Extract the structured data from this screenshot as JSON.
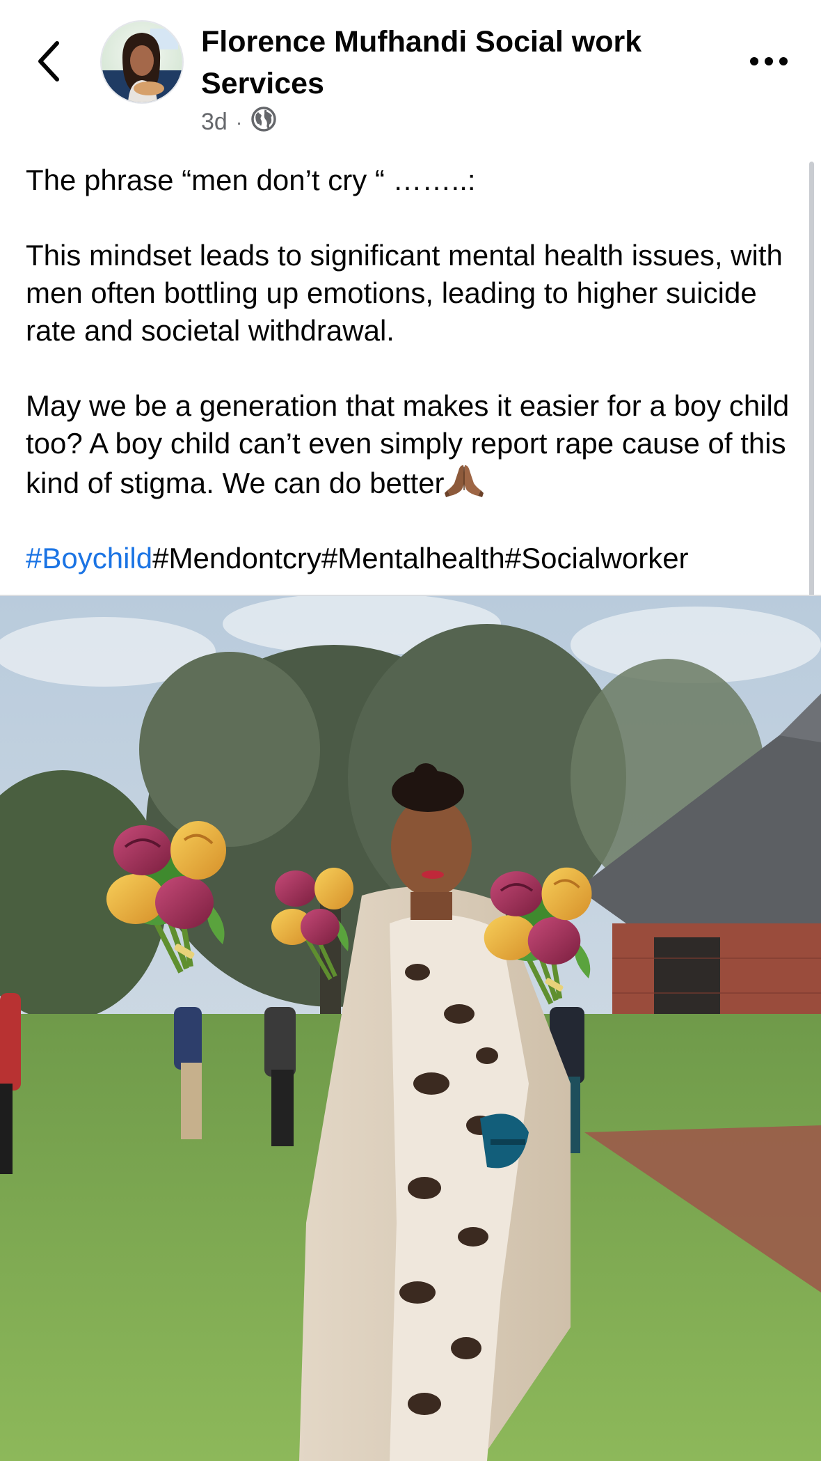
{
  "header": {
    "back_icon": "chevron-left-icon",
    "author_name": "Florence Mufhandi Social work Services",
    "timestamp": "3d",
    "separator": "·",
    "privacy_icon": "globe-icon",
    "more_icon": "more-horizontal-icon"
  },
  "post": {
    "paragraph_1": "The phrase “men don’t cry “ ……..:",
    "paragraph_2": "This mindset leads to significant mental health issues, with men often bottling up emotions, leading to higher suicide rate and societal withdrawal.",
    "paragraph_3": "May we be a generation that makes it easier for a boy child too? A boy child can’t even simply report rape cause of this kind of stigma. We can do better",
    "paragraph_3_emoji": "folded-hands-icon",
    "hashtags": [
      "#Boychild",
      "#Mendontcry",
      "#Mentalhealth",
      "#Socialworker"
    ]
  },
  "photo": {
    "subject": "photo-of-woman-in-garden-with-rose-bouquets"
  },
  "colors": {
    "link": "#1b74e4",
    "text": "#050505",
    "secondary_text": "#65676b",
    "divider": "#dadde1"
  }
}
